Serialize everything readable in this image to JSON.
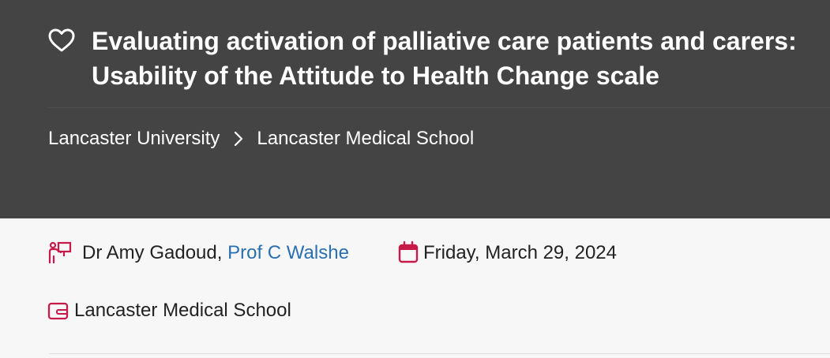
{
  "header": {
    "title": "Evaluating activation of palliative care patients and carers: Usability of the Attitude to Health Change scale",
    "favorite_icon": "heart-outline-icon",
    "breadcrumb": [
      {
        "label": "Lancaster University"
      },
      {
        "label": "Lancaster Medical School"
      }
    ]
  },
  "meta": {
    "people_icon": "presenter-icon",
    "author_1": "Dr Amy Gadoud",
    "separator": ", ",
    "author_2": "Prof C Walshe",
    "date_icon": "calendar-icon",
    "date": "Friday, March 29, 2024",
    "dept_icon": "wallet-icon",
    "department": "Lancaster Medical School"
  },
  "colors": {
    "hero_bg": "#444444",
    "accent": "#c8194b",
    "link": "#2a6fb0"
  }
}
